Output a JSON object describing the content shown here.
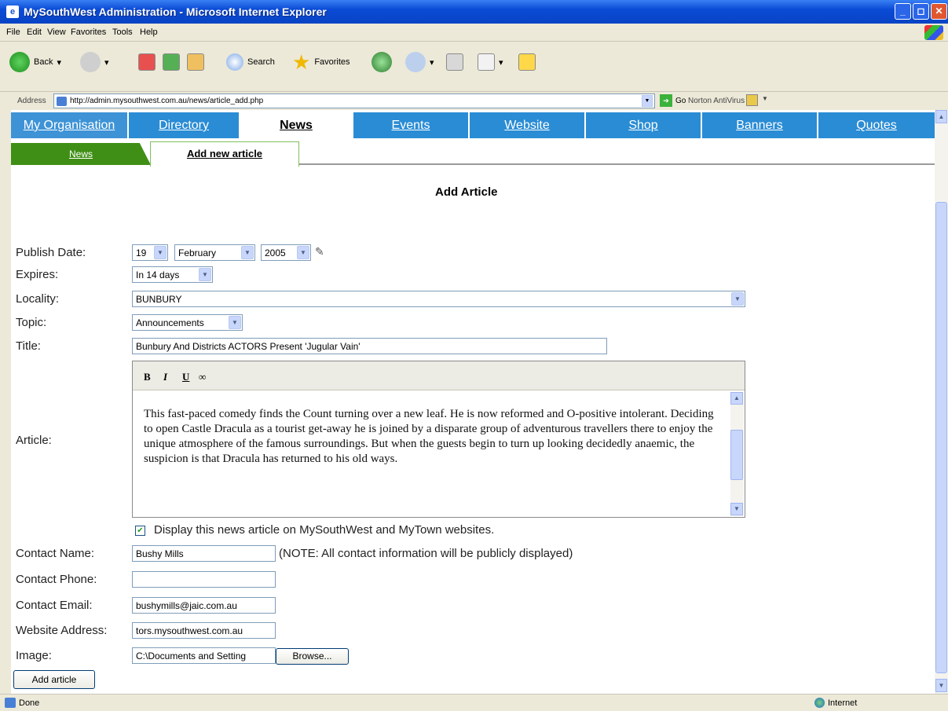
{
  "window": {
    "title": "MySouthWest Administration - Microsoft Internet Explorer"
  },
  "menu": [
    "File",
    "Edit",
    "View",
    "Favorites",
    "Tools",
    "Help"
  ],
  "toolbar": {
    "back": "Back",
    "search": "Search",
    "favorites": "Favorites"
  },
  "address": {
    "label": "Address",
    "url": "http://admin.mysouthwest.com.au/news/article_add.php",
    "go": "Go",
    "norton": "Norton AntiVirus"
  },
  "nav": {
    "tabs": [
      {
        "label": "My Organisation"
      },
      {
        "label": "Directory"
      },
      {
        "label": "News",
        "active": true
      },
      {
        "label": "Events"
      },
      {
        "label": "Website"
      },
      {
        "label": "Shop"
      },
      {
        "label": "Banners"
      },
      {
        "label": "Quotes"
      }
    ]
  },
  "subtabs": {
    "news": "News",
    "add": "Add new article"
  },
  "form": {
    "heading": "Add Article",
    "publish_date": {
      "label": "Publish Date:",
      "day": "19",
      "month": "February",
      "year": "2005"
    },
    "expires": {
      "label": "Expires:",
      "value": "In 14 days"
    },
    "locality": {
      "label": "Locality:",
      "value": "BUNBURY"
    },
    "topic": {
      "label": "Topic:",
      "value": "Announcements"
    },
    "title": {
      "label": "Title:",
      "value": "Bunbury And Districts ACTORS Present 'Jugular Vain'"
    },
    "article": {
      "label": "Article:",
      "toolbar": [
        "B",
        "I",
        "U",
        "∞"
      ],
      "text": "This fast-paced comedy finds the Count turning over a new leaf.  He is now reformed and O-positive intolerant.  Deciding to open Castle Dracula as a tourist get-away he is joined by a disparate group of adventurous travellers there to enjoy the unique atmosphere of the famous surroundings.  But when the guests begin to turn up looking decidedly anaemic, the suspicion is that Dracula has returned to his old ways."
    },
    "display_checkbox": {
      "label": "Display this news article on MySouthWest and MyTown websites.",
      "checked": true
    },
    "contact_name": {
      "label": "Contact Name:",
      "value": "Bushy Mills",
      "note": "(NOTE: All contact information will be publicly displayed)"
    },
    "contact_phone": {
      "label": "Contact Phone:",
      "value": ""
    },
    "contact_email": {
      "label": "Contact Email:",
      "value": "bushymills@jaic.com.au"
    },
    "website": {
      "label": "Website Address:",
      "value": "tors.mysouthwest.com.au"
    },
    "image": {
      "label": "Image:",
      "value": "C:\\Documents and Setting",
      "browse": "Browse..."
    },
    "submit": "Add article"
  },
  "status": {
    "left": "Done",
    "zone": "Internet"
  }
}
